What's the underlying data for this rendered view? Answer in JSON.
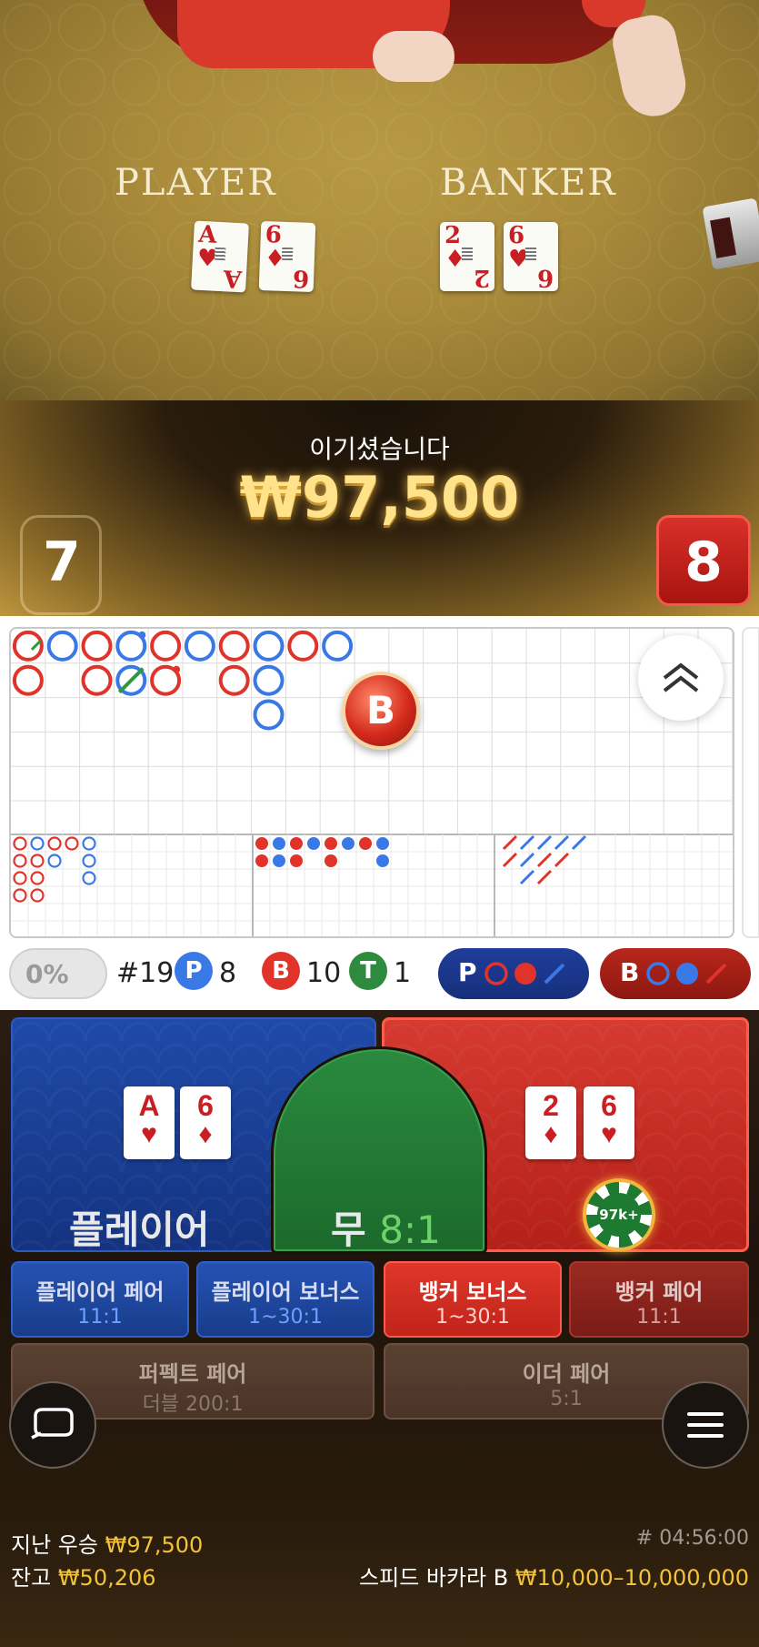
{
  "table": {
    "player_label": "PLAYER",
    "banker_label": "BANKER",
    "player_cards": [
      {
        "rank": "A",
        "suit": "♥"
      },
      {
        "rank": "6",
        "suit": "♦"
      }
    ],
    "banker_cards": [
      {
        "rank": "2",
        "suit": "♦"
      },
      {
        "rank": "6",
        "suit": "♥"
      }
    ]
  },
  "result": {
    "message": "이기셨습니다",
    "amount": "₩97,500",
    "player_score": "7",
    "banker_score": "8"
  },
  "roadmap": {
    "bead_big_road": [
      [
        "B-tie",
        "B"
      ],
      [
        "P"
      ],
      [
        "B",
        "B"
      ],
      [
        "P-pair",
        "T"
      ],
      [
        "B",
        "B-pair"
      ],
      [
        "P"
      ],
      [
        "B",
        "B"
      ],
      [
        "P",
        "P",
        "P"
      ],
      [
        "B"
      ],
      [
        "P"
      ]
    ],
    "latest_result": "B",
    "colors": {
      "banker": "#e0342a",
      "player": "#3a78e6",
      "tie": "#2e9a3e"
    }
  },
  "stats": {
    "percent": "0%",
    "round": "#19",
    "player_letter": "P",
    "player_count": "8",
    "banker_letter": "B",
    "banker_count": "10",
    "tie_letter": "T",
    "tie_count": "1",
    "predict_player": "P",
    "predict_banker": "B"
  },
  "bets": {
    "player": "플레이어",
    "tie_label": "무",
    "tie_odds": "8:1",
    "chip": "97k+",
    "side": [
      {
        "title": "플레이어 페어",
        "odds": "11:1"
      },
      {
        "title": "플레이어 보너스",
        "odds": "1~30:1"
      },
      {
        "title": "뱅커 보너스",
        "odds": "1~30:1"
      },
      {
        "title": "뱅커 페어",
        "odds": "11:1"
      },
      {
        "title": "퍼펙트 페어",
        "odds": "더블 200:1"
      },
      {
        "title": "이더 페어",
        "odds": "5:1"
      }
    ]
  },
  "footer": {
    "last_win_label": "지난 우승",
    "last_win_amount": "₩97,500",
    "balance_label": "잔고",
    "balance_amount": "₩50,206",
    "timer": "# 04:56:00",
    "game_name": "스피드 바카라 B",
    "limits": "₩10,000–10,000,000"
  }
}
